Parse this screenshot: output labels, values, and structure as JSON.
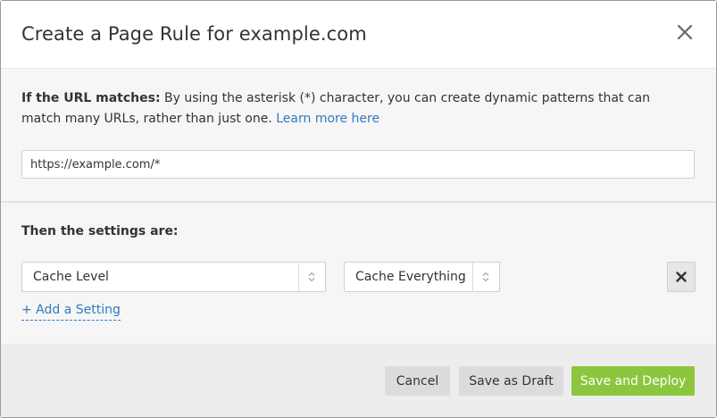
{
  "modal": {
    "title": "Create a Page Rule for example.com",
    "close_icon": "close-icon"
  },
  "url_section": {
    "label": "If the URL matches:",
    "description": " By using the asterisk (*) character, you can create dynamic patterns that can match many URLs, rather than just one. ",
    "learn_more": "Learn more here",
    "url_value": "https://example.com/*"
  },
  "settings_section": {
    "heading": "Then the settings are:",
    "setting_select": "Cache Level",
    "value_select": "Cache Everything",
    "remove_icon": "remove-icon",
    "add_setting": "+ Add a Setting"
  },
  "footer": {
    "cancel": "Cancel",
    "save_draft": "Save as Draft",
    "save_deploy": "Save and Deploy"
  },
  "colors": {
    "accent_green": "#8cc63f",
    "link_blue": "#2f7bbf",
    "panel_gray": "#f6f6f6",
    "footer_gray": "#ededed"
  }
}
